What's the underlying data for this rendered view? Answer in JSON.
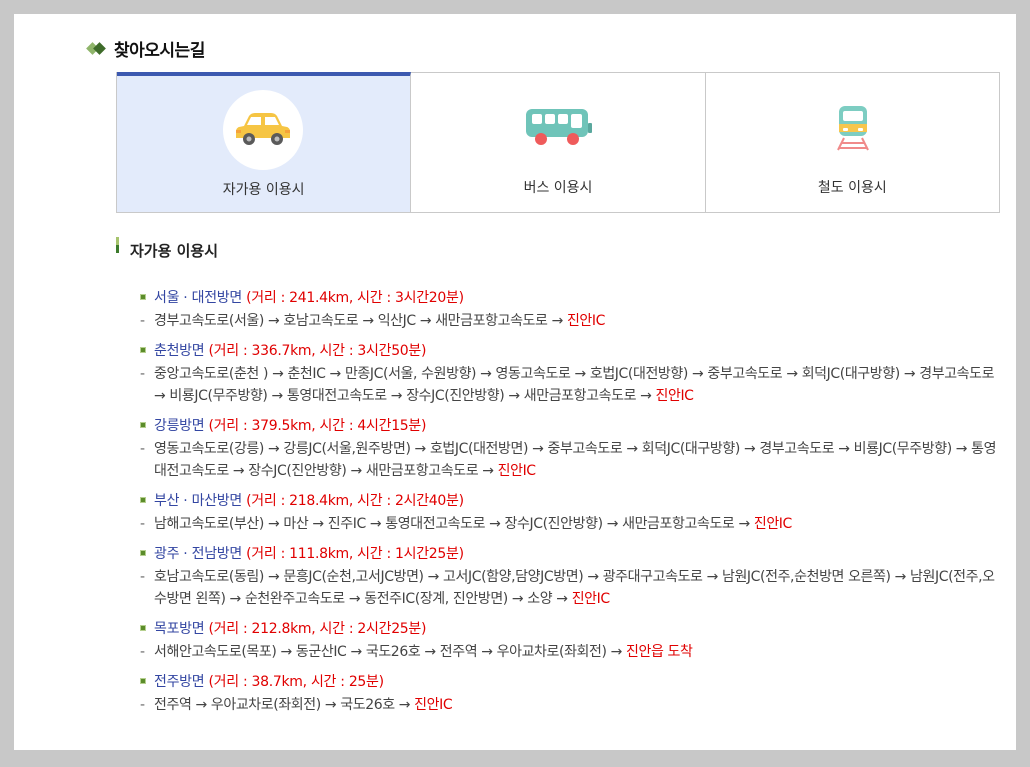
{
  "section_title": "찾아오시는길",
  "tabs": [
    {
      "label": "자가용 이용시",
      "icon": "car-icon",
      "active": true
    },
    {
      "label": "버스 이용시",
      "icon": "bus-icon",
      "active": false
    },
    {
      "label": "철도 이용시",
      "icon": "train-icon",
      "active": false
    }
  ],
  "sub_title": "자가용 이용시",
  "routes": [
    {
      "name": "서울 · 대전방면",
      "info": "(거리 : 241.4km, 시간 : 3시간20분)",
      "path": "경부고속도로(서울) → 호남고속도로 → 익산JC → 새만금포항고속도로 → ",
      "dest": "진안IC"
    },
    {
      "name": "춘천방면",
      "info": "(거리 : 336.7km, 시간 : 3시간50분)",
      "path": "중앙고속도로(춘천 ) → 춘천IC → 만종JC(서울, 수원방향) → 영동고속도로 → 호법JC(대전방향) → 중부고속도로 → 회덕JC(대구방향) → 경부고속도로 → 비룡JC(무주방향) → 통영대전고속도로 → 장수JC(진안방향) → 새만금포항고속도로 → ",
      "dest": "진안IC"
    },
    {
      "name": "강릉방면",
      "info": "(거리 : 379.5km, 시간 : 4시간15분)",
      "path": "영동고속도로(강릉) → 강릉JC(서울,원주방면) → 호법JC(대전방면) → 중부고속도로 → 회덕JC(대구방향) → 경부고속도로 → 비룡JC(무주방향) → 통영대전고속도로 → 장수JC(진안방향) → 새만금포항고속도로 → ",
      "dest": "진안IC"
    },
    {
      "name": "부산 · 마산방면",
      "info": "(거리 : 218.4km, 시간 : 2시간40분)",
      "path": "남해고속도로(부산) → 마산 → 진주IC → 통영대전고속도로 → 장수JC(진안방향) → 새만금포항고속도로 → ",
      "dest": "진안IC"
    },
    {
      "name": "광주 · 전남방면",
      "info": "(거리 : 111.8km, 시간 : 1시간25분)",
      "path": "호남고속도로(동림) → 문흥JC(순천,고서JC방면) → 고서JC(함양,담양JC방면) → 광주대구고속도로 → 남원JC(전주,순천방면 오른쪽) → 남원JC(전주,오수방면 왼쪽) → 순천완주고속도로 → 동전주IC(장계, 진안방면) → 소양 → ",
      "dest": "진안IC"
    },
    {
      "name": "목포방면",
      "info": "(거리 : 212.8km, 시간 : 2시간25분)",
      "path": "서해안고속도로(목포) → 동군산IC → 국도26호 → 전주역 → 우아교차로(좌회전) → ",
      "dest": "진안읍 도착"
    },
    {
      "name": "전주방면",
      "info": "(거리 : 38.7km, 시간 : 25분)",
      "path": "전주역 → 우아교차로(좌회전) → 국도26호 → ",
      "dest": "진안IC"
    }
  ]
}
